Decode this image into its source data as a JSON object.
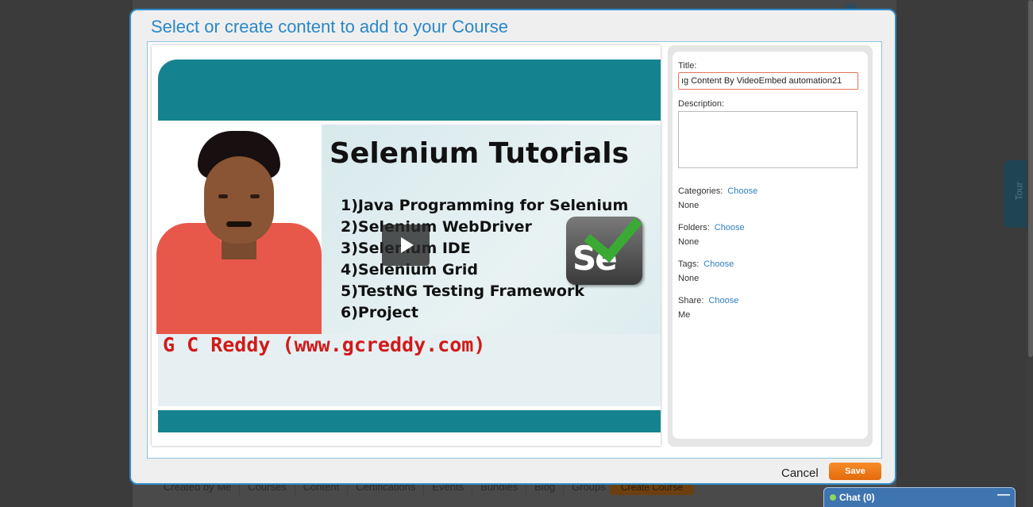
{
  "background": {
    "tabs": [
      "Courses",
      "Content",
      "Certifications",
      "Events",
      "Bundles",
      "Blog",
      "Groups"
    ],
    "create_button": "Create Course",
    "footer_text": "Created by Me",
    "tour_label": "Tour"
  },
  "modal": {
    "title": "Select or create content to add to your Course",
    "video": {
      "slide_title": "Selenium Tutorials",
      "topics": [
        "1)Java Programming for Selenium",
        "2)Selenium WebDriver",
        "3)Selenium IDE",
        "4)Selenium Grid",
        "5)TestNG Testing Framework",
        "6)Project"
      ],
      "footer": "G C Reddy (www.gcreddy.com)",
      "logo_text": "Se",
      "play_icon": "play-icon"
    },
    "form": {
      "title_label": "Title:",
      "title_value": "ıg Content By VideoEmbed automation21",
      "description_label": "Description:",
      "description_value": "",
      "categories_label": "Categories:",
      "categories_value": "None",
      "folders_label": "Folders:",
      "folders_value": "None",
      "tags_label": "Tags:",
      "tags_value": "None",
      "share_label": "Share:",
      "share_value": "Me",
      "choose_label": "Choose"
    },
    "cancel_label": "Cancel",
    "save_label": "Save"
  },
  "chat": {
    "label": "Chat (0)",
    "minimize": "—"
  },
  "colors": {
    "accent": "#2f8ccc",
    "save": "#f07a1a",
    "teal": "#15838f",
    "link": "#2f7fc1"
  }
}
